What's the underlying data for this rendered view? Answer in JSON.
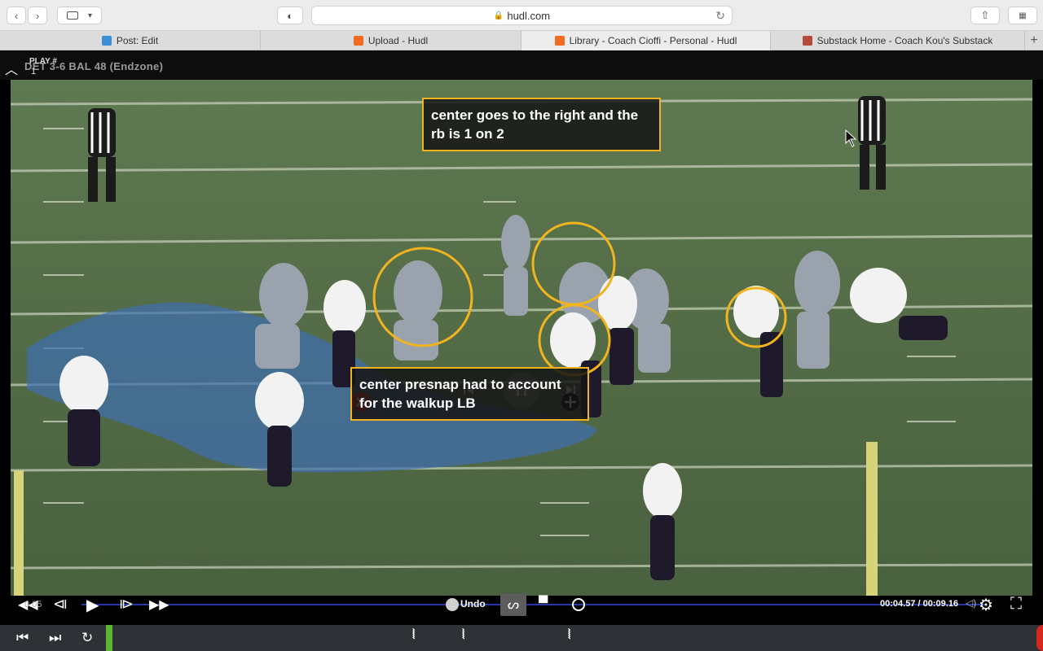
{
  "browser": {
    "url": "hudl.com",
    "tabs": [
      {
        "label": "Post: Edit",
        "favicon_color": "#3b8fd6",
        "active": false
      },
      {
        "label": "Upload - Hudl",
        "favicon_color": "#f26b21",
        "active": false
      },
      {
        "label": "Library - Coach Cioffi - Personal - Hudl",
        "favicon_color": "#f26b21",
        "active": true
      },
      {
        "label": "Substack Home - Coach Kou's Substack",
        "favicon_color": "#b5493a",
        "active": false
      }
    ]
  },
  "player": {
    "play_label": "PLAY #",
    "play_number": "1",
    "clip_title": "DET 3-6  BAL 48 (Endzone)",
    "annotations": [
      {
        "text": "center goes to the right and the rb is 1 on 2"
      },
      {
        "text": "center presnap had to account for the walkup LB"
      }
    ],
    "controls": {
      "speed_label": "0.05",
      "undo_label": "Undo",
      "time_current": "00:04.57",
      "time_total": "00:09.16",
      "progress": 0.41
    }
  },
  "colors": {
    "annotation_border": "#f2b41e",
    "timeline": "#2a35a8",
    "green_marker": "#5bb432",
    "delete": "#d6261f"
  }
}
